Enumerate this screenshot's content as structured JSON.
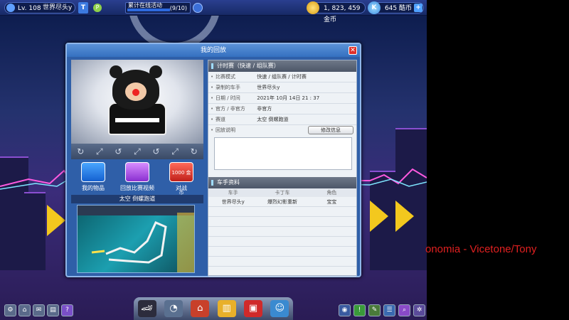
{
  "topbar": {
    "level": "Lv. 108",
    "username": "世界尽头y",
    "t_label": "T",
    "p_label": "P",
    "task_label": "累计在线活动",
    "task_count": "(9/10)",
    "gold": "1, 823, 459 金币",
    "kcoin_label": "K",
    "kcoin": "645 酷币",
    "plus": "+"
  },
  "dialog": {
    "title": "我的回放",
    "close": "✕",
    "actions": [
      {
        "label": "我的物品",
        "button": ""
      },
      {
        "label": "回放比赛视频",
        "button": ""
      },
      {
        "label": "对战",
        "button": "1000 金币"
      }
    ],
    "track_title": "太空 倒螺跑道",
    "info_header": "计时赛（快速 / 组队赛）",
    "info": [
      {
        "label": "比赛模式",
        "value": "快速 / 组队赛 / 计时赛"
      },
      {
        "label": "录制的车手",
        "value": "世界尽头y"
      },
      {
        "label": "日期 / 时间",
        "value": "2021年 10月 14日 21 : 37"
      },
      {
        "label": "官方 / 非官方",
        "value": "非官方"
      },
      {
        "label": "赛道",
        "value": "太空 倒螺跑道"
      },
      {
        "label": "回放说明",
        "value": ""
      }
    ],
    "edit_button": "修改信息",
    "driver_header": "车手资料",
    "driver_columns": [
      "车手",
      "卡丁车",
      "角色"
    ],
    "drivers": [
      {
        "name": "世界尽头y",
        "kart": "爆烈幻影重新",
        "role": "宝宝"
      }
    ]
  },
  "caption": "onomia - Vicetone/Tony"
}
